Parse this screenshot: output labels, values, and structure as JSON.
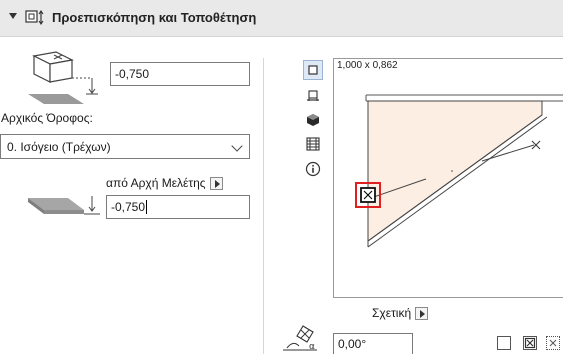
{
  "header": {
    "title": "Προεπισκόπηση και Τοποθέτηση",
    "collapse_icon": "triangle-down-icon",
    "panel_icon": "preview-placement-icon"
  },
  "left": {
    "height_value": "-0,750",
    "home_story_label": "Αρχικός Όροφος:",
    "home_story_value": "0. Ισόγειο (Τρέχων)",
    "reference_label": "από Αρχή Μελέτης",
    "offset_value": "-0,750"
  },
  "tools": [
    {
      "name": "floor-plan-icon",
      "selected": true
    },
    {
      "name": "section-icon",
      "selected": false
    },
    {
      "name": "3d-view-icon",
      "selected": false
    },
    {
      "name": "list-icon",
      "selected": false
    },
    {
      "name": "info-icon",
      "selected": false
    }
  ],
  "preview": {
    "dimension_text": "1,000 x 0,862"
  },
  "bottom": {
    "relative_label": "Σχετική",
    "angle_value": "0,00°"
  },
  "colors": {
    "header_bg": "#e9e9e9",
    "shape_fill": "#fdeee3",
    "highlight": "#e02020"
  }
}
